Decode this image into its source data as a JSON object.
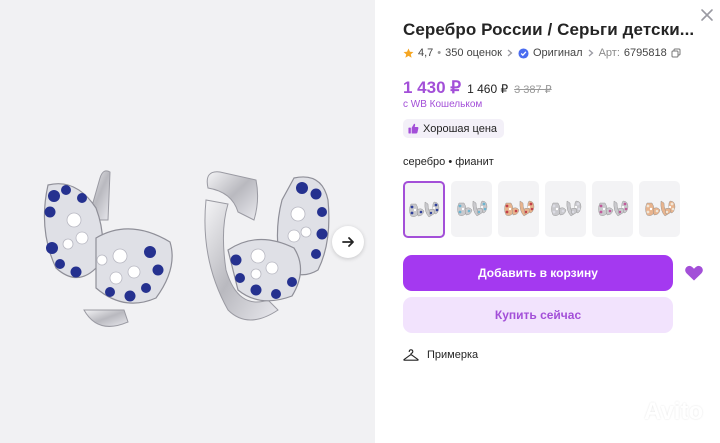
{
  "product": {
    "title": "Серебро России / Серьги детски...",
    "rating": "4,7",
    "reviews": "350 оценок",
    "original_label": "Оригинал",
    "article_label": "Арт:",
    "article": "6795818"
  },
  "price": {
    "main": "1 430 ₽",
    "second": "1 460 ₽",
    "old": "3 387 ₽",
    "wallet_note": "с WB Кошельком"
  },
  "badge": {
    "label": "Хорошая цена"
  },
  "material": "серебро • фианит",
  "variants": [
    {
      "name": "silver-sapphire",
      "stone": "#2e3f9a",
      "metal": "#c9c9cd",
      "selected": true
    },
    {
      "name": "silver-aqua",
      "stone": "#6db4d0",
      "metal": "#c9c9cd",
      "selected": false
    },
    {
      "name": "gold-garnet",
      "stone": "#c2404a",
      "metal": "#e8b48e",
      "selected": false
    },
    {
      "name": "silver-white",
      "stone": "#dcdce4",
      "metal": "#c9c9cd",
      "selected": false
    },
    {
      "name": "silver-rose",
      "stone": "#c05a9a",
      "metal": "#c9c9cd",
      "selected": false
    },
    {
      "name": "gold-white",
      "stone": "#f0e6d8",
      "metal": "#e8b48e",
      "selected": false
    }
  ],
  "actions": {
    "add_to_cart": "Добавить в корзину",
    "buy_now": "Купить сейчас",
    "fitting": "Примерка"
  },
  "watermark": "Avito",
  "colors": {
    "accent": "#a34fd8",
    "cart_button": "#a439f0",
    "buy_button_bg": "#f2e3fd",
    "star": "#f5a623",
    "original_check": "#4a6cf0"
  }
}
